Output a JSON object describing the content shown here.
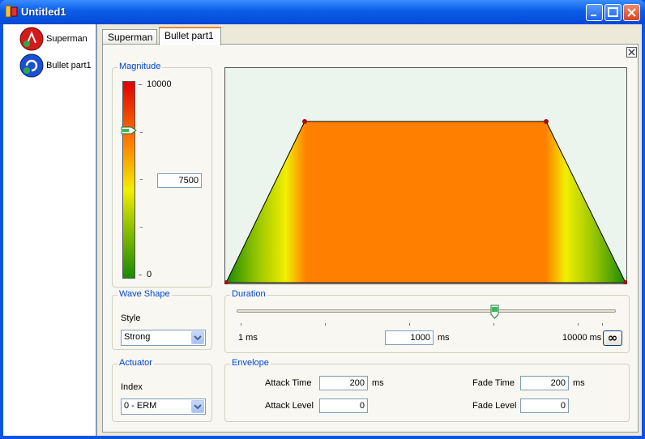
{
  "window": {
    "title": "Untitled1"
  },
  "sidebar": {
    "items": [
      {
        "label": "Superman"
      },
      {
        "label": "Bullet part1"
      }
    ]
  },
  "tabs": [
    {
      "label": "Superman"
    },
    {
      "label": "Bullet part1"
    }
  ],
  "magnitude": {
    "title": "Magnitude",
    "max_label": "10000",
    "min_label": "0",
    "value": "7500",
    "level": 0.75
  },
  "wave_shape": {
    "title": "Wave Shape",
    "style_label": "Style",
    "style_value": "Strong"
  },
  "actuator": {
    "title": "Actuator",
    "index_label": "Index",
    "index_value": "0 - ERM"
  },
  "duration": {
    "title": "Duration",
    "min_label": "1 ms",
    "value": "1000",
    "unit": "ms",
    "max_label": "10000 ms",
    "infinity_symbol": "∞",
    "slider_fraction": 0.68
  },
  "envelope": {
    "title": "Envelope",
    "attack_time_label": "Attack Time",
    "attack_time_value": "200",
    "attack_time_unit": "ms",
    "attack_level_label": "Attack Level",
    "attack_level_value": "0",
    "fade_time_label": "Fade Time",
    "fade_time_value": "200",
    "fade_time_unit": "ms",
    "fade_level_label": "Fade Level",
    "fade_level_value": "0"
  },
  "colors": {
    "accent_tab": "#e68b2c",
    "group_title": "#0046d5",
    "wave_fill": "#ff8000"
  }
}
